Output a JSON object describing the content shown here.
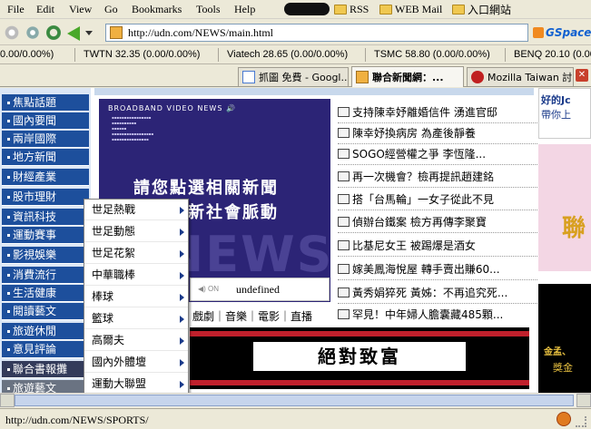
{
  "menubar": {
    "items": [
      "File",
      "Edit",
      "View",
      "Go",
      "Bookmarks",
      "Tools",
      "Help"
    ],
    "bookmarks": [
      "RSS",
      "WEB Mail",
      "入口網站"
    ]
  },
  "navbar": {
    "url": "http://udn.com/NEWS/main.html",
    "toolbar_label": "GSpace"
  },
  "ticker": [
    "0.00/0.00%)",
    "TWTN 32.35 (0.00/0.00%)",
    "Viatech 28.65 (0.00/0.00%)",
    "TSMC 58.80 (0.00/0.00%)",
    "BENQ 20.10 (0.00/0.00%)"
  ],
  "tabs": [
    {
      "label": "抓圖 免費 - Googl..."
    },
    {
      "label": "聯合新聞網：..."
    },
    {
      "label": "Mozilla Taiwan 討..."
    }
  ],
  "sidebar": [
    "焦點話題",
    "國內要聞",
    "兩岸國際",
    "地方新聞",
    "財經產業",
    "股市理財",
    "資訊科技",
    "運動賽事",
    "影視娛樂",
    "消費流行",
    "生活健康",
    "閱讀藝文",
    "旅遊休閒",
    "意見評論",
    "聯合書報攤",
    "旅遊藝文"
  ],
  "video": {
    "brand": "BROADBAND VIDEO NEWS",
    "line1": "請您點選相關新聞",
    "line2": "掌握最新社會脈動",
    "watermark": "NEWS",
    "toggle": "ON",
    "status": "undefined"
  },
  "categories": "戲劇｜音樂｜電影｜直播",
  "headlines": [
    "支持陳幸妤離婚信件 湧進官邸",
    "陳幸妤換病房 為產後靜養",
    "SOGO經營權之爭 李恆隆...",
    "再一次機會？檢再提訊趙建銘",
    "搭「台馬輪」一女子從此不見",
    "偵辦台鐵案 檢方再傳李聚寶",
    "比基尼女王 被踢爆是酒女",
    "嫁美鳳海悅屋 轉手賣出賺60...",
    "黃秀娟猝死 黃姊：不再追究死...",
    "罕見！中年婦人膽囊藏485顆..."
  ],
  "banner": {
    "text": "絕對致富"
  },
  "right_ads": {
    "top1": "好的Jc",
    "top2": "帶你上",
    "mid": "聯",
    "bot1": "金孟、",
    "bot2": "獎金"
  },
  "popup_menu": [
    "世足熱戰",
    "世足動態",
    "世足花絮",
    "中華職棒",
    "棒球",
    "籃球",
    "高爾夫",
    "國內外體壇",
    "運動大聯盟"
  ],
  "status": {
    "text": "http://udn.com/NEWS/SPORTS/"
  }
}
